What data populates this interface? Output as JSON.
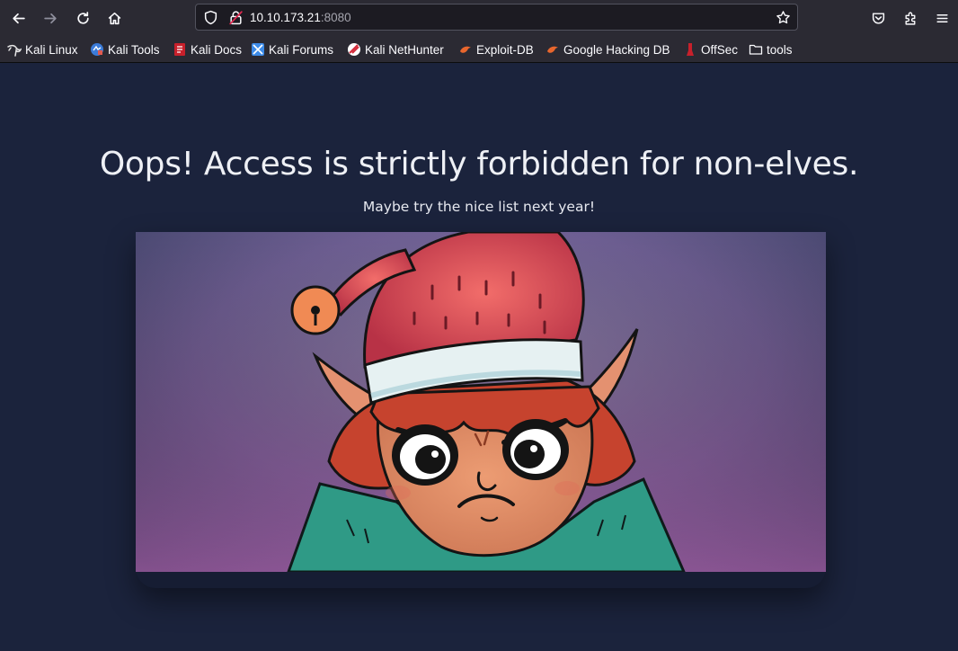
{
  "browser": {
    "url_host": "10.10.173.21",
    "url_port": ":8080",
    "icons": {
      "back": "arrow-left-icon",
      "forward": "arrow-right-icon",
      "reload": "reload-icon",
      "home": "home-icon",
      "shield": "shield-icon",
      "lock": "insecure-lock-icon",
      "bookmark": "star-icon",
      "pocket": "pocket-icon",
      "extensions": "puzzle-icon",
      "menu": "hamburger-icon"
    }
  },
  "bookmarks": [
    {
      "label": "Kali Linux",
      "icon": "kali-dragon-icon"
    },
    {
      "label": "Kali Tools",
      "icon": "kali-tools-icon"
    },
    {
      "label": "Kali Docs",
      "icon": "kali-docs-icon"
    },
    {
      "label": "Kali Forums",
      "icon": "kali-forums-icon"
    },
    {
      "label": "Kali NetHunter",
      "icon": "nethunter-icon"
    },
    {
      "label": "Exploit-DB",
      "icon": "exploit-db-icon"
    },
    {
      "label": "Google Hacking DB",
      "icon": "ghdb-icon"
    },
    {
      "label": "OffSec",
      "icon": "offsec-icon"
    },
    {
      "label": "tools",
      "icon": "folder-icon"
    }
  ],
  "page": {
    "headline": "Oops! Access is strictly forbidden for non-elves.",
    "subline": "Maybe try the nice list next year!",
    "image": "grumpy-elf-illustration"
  },
  "colors": {
    "page_background": "#1b233c",
    "toolbar": "#2b2a33",
    "elf_hat": "#d9444f",
    "elf_skin": "#dd8a62",
    "elf_hair": "#c6432e",
    "elf_collar": "#2f9a86"
  }
}
